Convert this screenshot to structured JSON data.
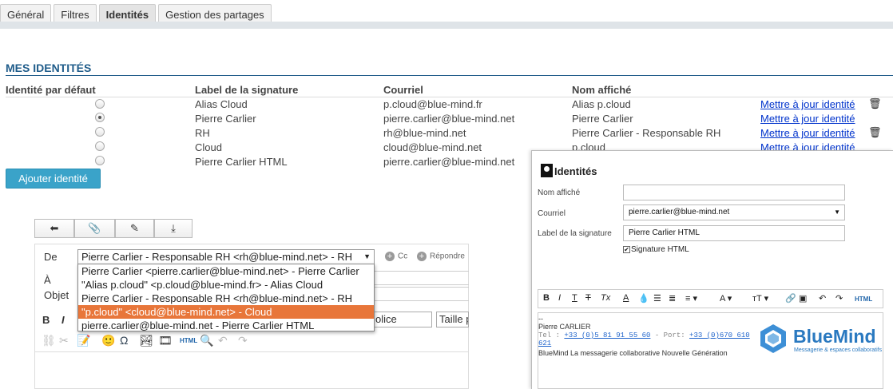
{
  "tabs": [
    {
      "label": "Général"
    },
    {
      "label": "Filtres"
    },
    {
      "label": "Identités"
    },
    {
      "label": "Gestion des partages"
    }
  ],
  "section_title": "MES IDENTITÉS",
  "columns": {
    "default": "Identité par défaut",
    "label": "Label de la signature",
    "email": "Courriel",
    "name": "Nom affiché"
  },
  "identities": [
    {
      "label": "Alias Cloud",
      "email": "p.cloud@blue-mind.fr",
      "name": "Alias p.cloud",
      "action": "Mettre à jour identité"
    },
    {
      "label": "Pierre Carlier",
      "email": "pierre.carlier@blue-mind.net",
      "name": "Pierre Carlier",
      "action": "Mettre à jour identité"
    },
    {
      "label": "RH",
      "email": "rh@blue-mind.net",
      "name": "Pierre Carlier - Responsable RH",
      "action": "Mettre à jour identité"
    },
    {
      "label": "Cloud",
      "email": "cloud@blue-mind.net",
      "name": "p.cloud",
      "action": "Mettre à jour identité"
    },
    {
      "label": "Pierre Carlier HTML",
      "email": "pierre.carlier@blue-mind.net",
      "name": "",
      "action": ""
    }
  ],
  "default_identity_index": 1,
  "add_button": "Ajouter identité",
  "compose": {
    "from_label": "De",
    "to_label": "À",
    "subject_label": "Objet",
    "from_value": "Pierre Carlier - Responsable RH <rh@blue-mind.net> - RH",
    "cc_label": "Cc",
    "reply_label": "Répondre",
    "options": [
      "Pierre Carlier <pierre.carlier@blue-mind.net> - Pierre Carlier",
      "\"Alias p.cloud\" <p.cloud@blue-mind.fr> - Alias Cloud",
      "Pierre Carlier - Responsable RH <rh@blue-mind.net> - RH",
      "\"p.cloud\" <cloud@blue-mind.net> - Cloud",
      "pierre.carlier@blue-mind.net - Pierre Carlier HTML"
    ],
    "highlighted_option": 3,
    "font_select": "olice",
    "size_select": "Taille p"
  },
  "panel": {
    "title": "Identités",
    "display_name_label": "Nom affiché",
    "display_name_value": "",
    "email_label": "Courriel",
    "email_value": "pierre.carlier@blue-mind.net",
    "sig_label": "Label de la signature",
    "sig_value": "Pierre Carlier HTML",
    "html_sig_label": "Signature HTML",
    "html_button": "HTML",
    "signature": {
      "dash": "--",
      "name": "Pierre CARLIER",
      "tel_prefix": "Tel : ",
      "tel": "+33 (0)5 81 91 55 60",
      "port_prefix": " - Port: ",
      "port": "+33 (0)670 610",
      "port_cont": "621",
      "tagline": "BlueMind La messagerie collaborative Nouvelle Génération"
    },
    "logo_text": "BlueMind",
    "logo_sub": "Messagerie & espaces collaboratifs"
  }
}
